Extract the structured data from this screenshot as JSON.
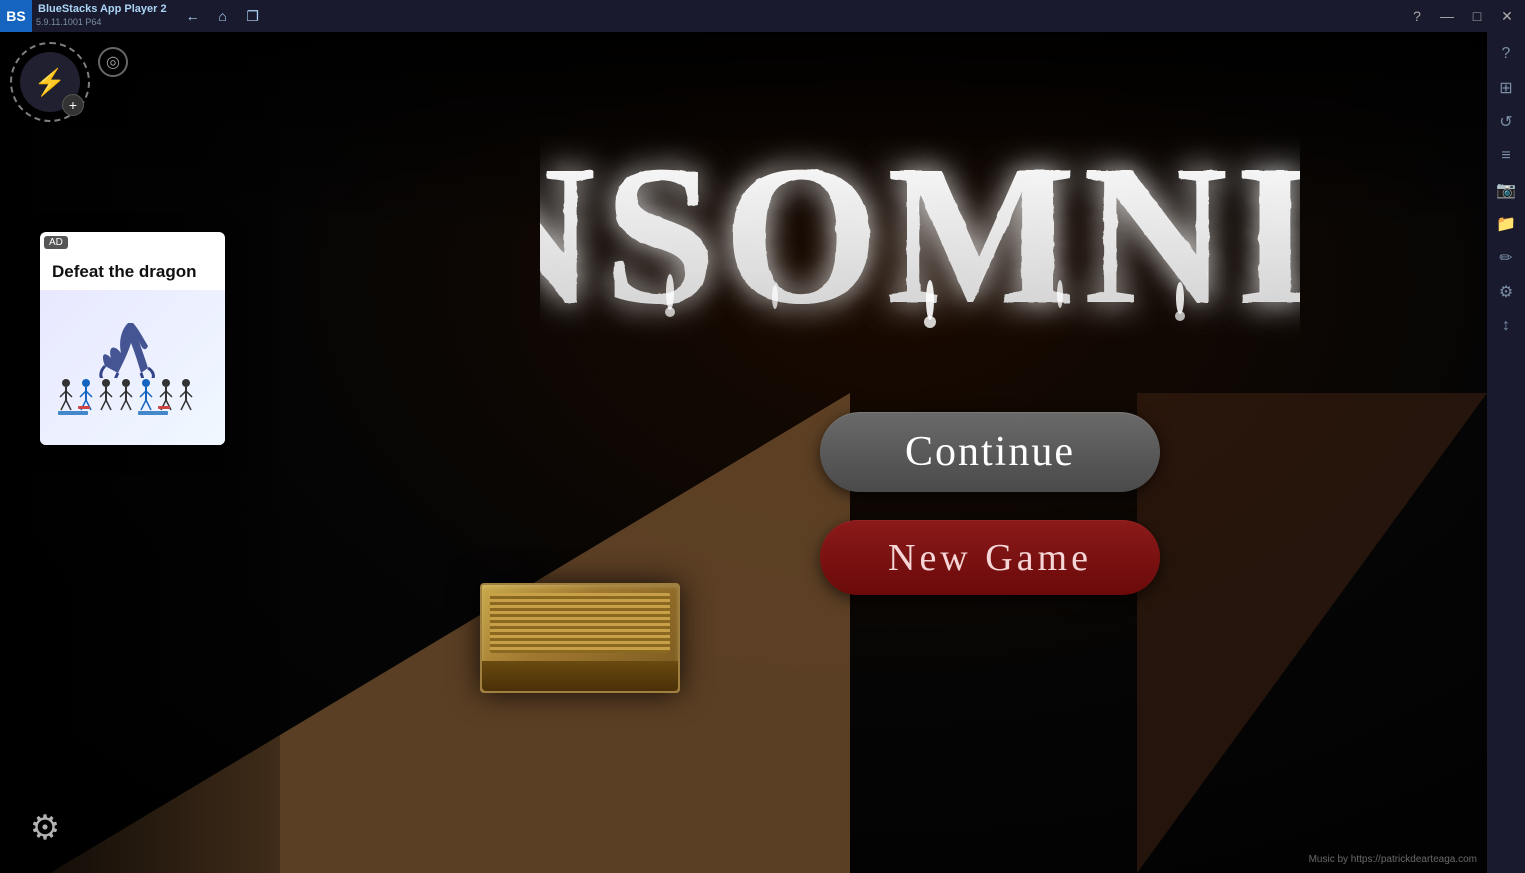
{
  "titlebar": {
    "app_name": "BlueStacks App Player 2",
    "version": "5.9.11.1001  P64",
    "logo_text": "BS"
  },
  "game": {
    "title": "INSOMNIA",
    "btn_continue": "Continue",
    "btn_newgame": "New Game",
    "attribution": "Music by  https://patrickdearteaga.com"
  },
  "ad": {
    "tag": "AD",
    "headline": "Defeat the dragon"
  },
  "icons": {
    "lightning": "⚡",
    "plus": "+",
    "compass": "◎",
    "settings": "⚙",
    "help": "?",
    "minimize": "—",
    "maximize": "□",
    "close": "✕",
    "back": "←",
    "home": "⌂",
    "windows": "❐"
  },
  "sidebar_icons": [
    "?",
    "⊞",
    "↺",
    "≡",
    "📷",
    "📁",
    "✏",
    "⚙",
    "↕"
  ]
}
